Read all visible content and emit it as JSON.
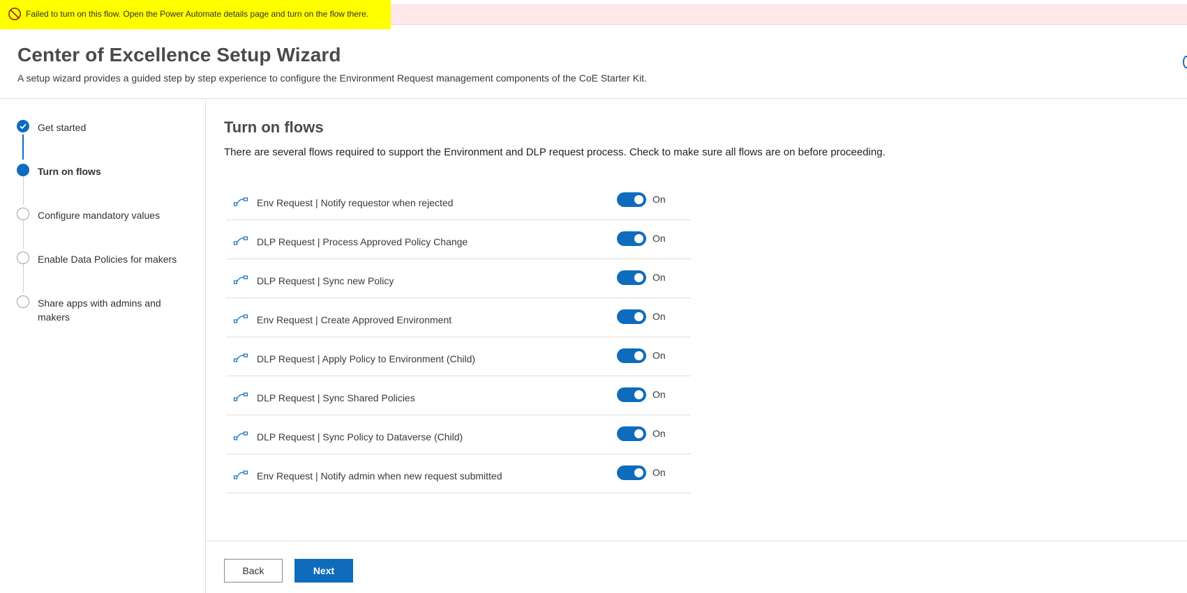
{
  "error_bar": {
    "message": "Failed to turn on this flow. Open the Power Automate details page and turn on the flow there.",
    "icon": "blocked-icon",
    "background": "#fde7e9",
    "highlight": "#ffff00"
  },
  "header": {
    "title": "Center of Excellence Setup Wizard",
    "subtitle": "A setup wizard provides a guided step by step experience to configure the Environment Request management components of the CoE Starter Kit."
  },
  "steps": [
    {
      "label": "Get started",
      "state": "completed"
    },
    {
      "label": "Turn on flows",
      "state": "current"
    },
    {
      "label": "Configure mandatory values",
      "state": "pending"
    },
    {
      "label": "Enable Data Policies for makers",
      "state": "pending"
    },
    {
      "label": "Share apps with admins and makers",
      "state": "pending"
    }
  ],
  "main": {
    "title": "Turn on flows",
    "description": "There are several flows required to support the Environment and DLP request process. Check to make sure all flows are on before proceeding.",
    "flows": [
      {
        "name": "Env Request | Notify requestor when rejected",
        "status": "On",
        "on": true
      },
      {
        "name": "DLP Request | Process Approved Policy Change",
        "status": "On",
        "on": true
      },
      {
        "name": "DLP Request | Sync new Policy",
        "status": "On",
        "on": true
      },
      {
        "name": "Env Request | Create Approved Environment",
        "status": "On",
        "on": true
      },
      {
        "name": "DLP Request | Apply Policy to Environment (Child)",
        "status": "On",
        "on": true
      },
      {
        "name": "DLP Request | Sync Shared Policies",
        "status": "On",
        "on": true
      },
      {
        "name": "DLP Request | Sync Policy to Dataverse (Child)",
        "status": "On",
        "on": true
      },
      {
        "name": "Env Request | Notify admin when new request submitted",
        "status": "On",
        "on": true
      }
    ]
  },
  "footer": {
    "back_label": "Back",
    "next_label": "Next"
  },
  "colors": {
    "accent": "#0f6cbd"
  }
}
